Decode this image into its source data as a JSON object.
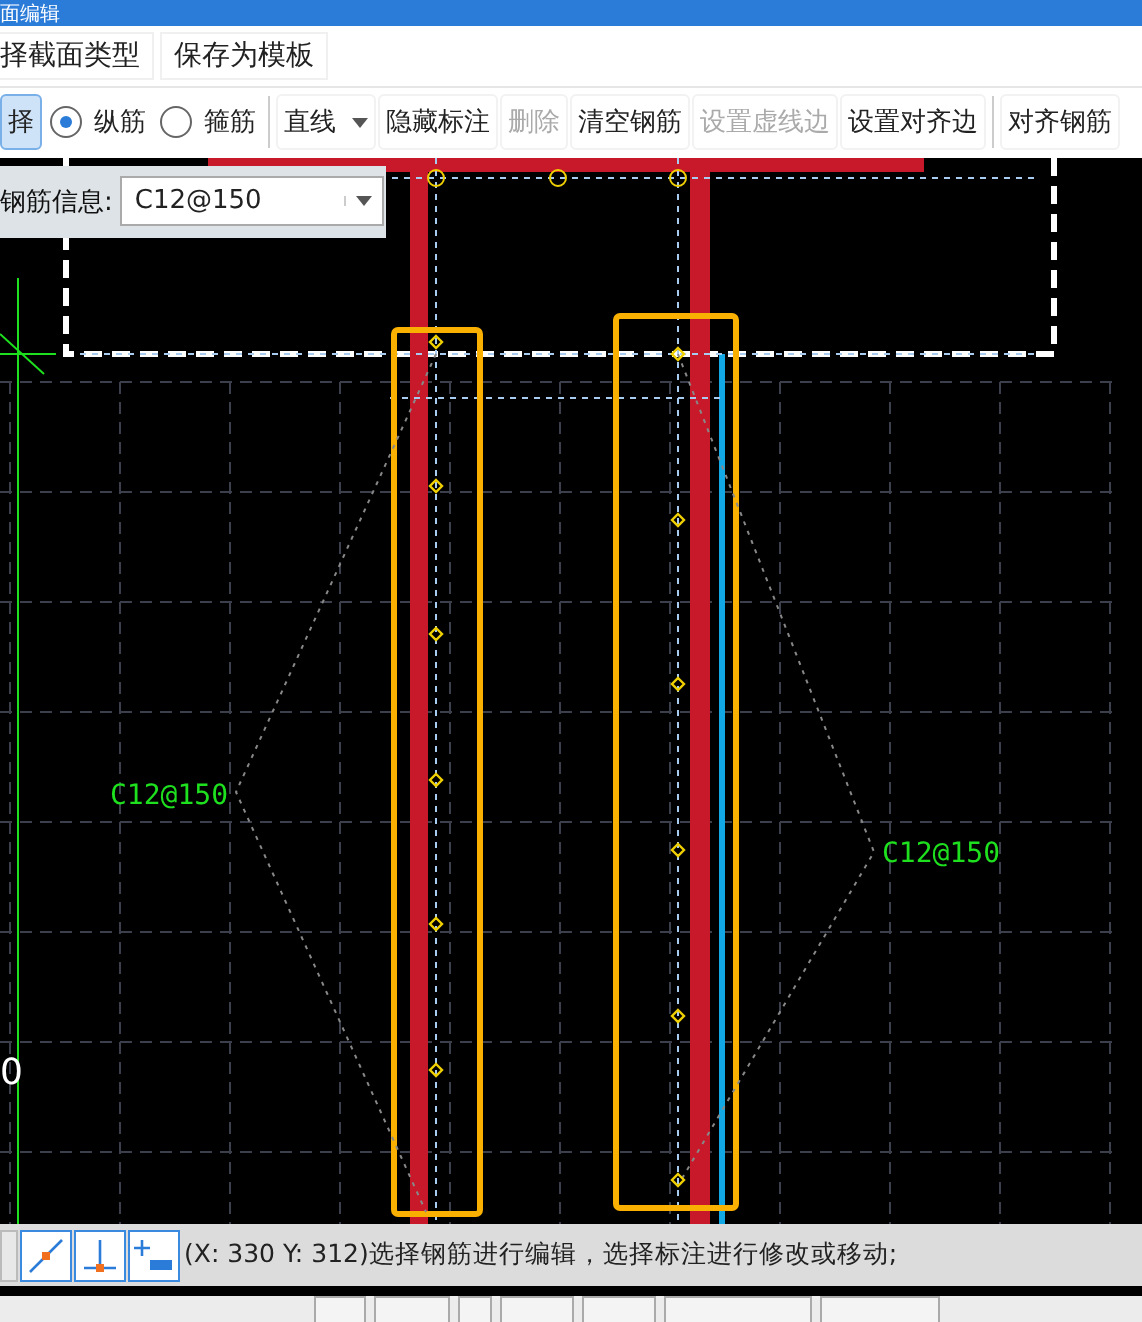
{
  "window": {
    "title": "面编辑"
  },
  "menu": [
    {
      "label": "择截面类型"
    },
    {
      "label": "保存为模板"
    }
  ],
  "toolbar": [
    {
      "kind": "button",
      "label": "择",
      "selected": true,
      "disabled": false
    },
    {
      "kind": "radio",
      "label": "纵筋",
      "selected": true
    },
    {
      "kind": "radio",
      "label": "箍筋",
      "selected": false
    },
    {
      "kind": "separator"
    },
    {
      "kind": "dropdown",
      "label": "直线"
    },
    {
      "kind": "button",
      "label": "隐藏标注",
      "selected": false,
      "disabled": false
    },
    {
      "kind": "button",
      "label": "删除",
      "selected": false,
      "disabled": true
    },
    {
      "kind": "button",
      "label": "清空钢筋",
      "selected": false,
      "disabled": false
    },
    {
      "kind": "button",
      "label": "设置虚线边",
      "selected": false,
      "disabled": true
    },
    {
      "kind": "button",
      "label": "设置对齐边",
      "selected": false,
      "disabled": false
    },
    {
      "kind": "separator"
    },
    {
      "kind": "button",
      "label": "对齐钢筋",
      "selected": false,
      "disabled": false
    }
  ],
  "rebar_info": {
    "label": "钢筋信息:",
    "value": "C12@150"
  },
  "canvas": {
    "annotations": [
      {
        "text": "C12@150"
      },
      {
        "text": "C12@150"
      }
    ],
    "axis_label": "0"
  },
  "status_bar": {
    "text": "(X: 330 Y: 312)选择钢筋进行编辑，选择标注进行修改或移动;"
  }
}
